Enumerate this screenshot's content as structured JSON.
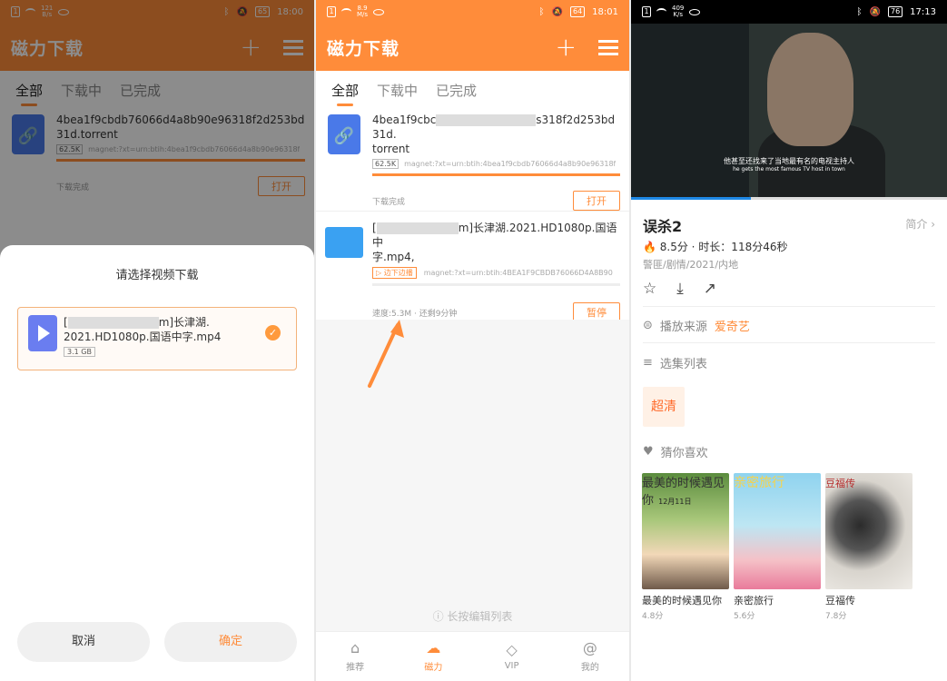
{
  "panel1": {
    "status": {
      "speed_top": "121",
      "speed_unit": "B/s",
      "battery": "65",
      "time": "18:00"
    },
    "appbar": {
      "title": "磁力下载"
    },
    "tabs": [
      "全部",
      "下载中",
      "已完成"
    ],
    "item": {
      "name": "4bea1f9cbdb76066d4a8b90e96318f2d253bd31d.torrent",
      "size": "62.5K",
      "magnet": "magnet:?xt=urn:btih:4bea1f9cbdb76066d4a8b90e96318f",
      "progress_fraction": 1.0,
      "status": "下载完成",
      "action": "打开"
    },
    "sheet": {
      "title": "请选择视频下载",
      "file_prefix": "[",
      "file_suffix": "m]长津湖.",
      "file_line2": "2021.HD1080p.国语中字.mp4",
      "file_size": "3.1 GB",
      "check": "✓",
      "cancel": "取消",
      "confirm": "确定"
    }
  },
  "panel2": {
    "status": {
      "speed_top": "8.9",
      "speed_unit": "M/s",
      "battery": "64",
      "time": "18:01"
    },
    "appbar": {
      "title": "磁力下载"
    },
    "tabs": [
      "全部",
      "下载中",
      "已完成"
    ],
    "item1": {
      "name_start": "4bea1f9cbc",
      "name_end": "s318f2d253bd31d.",
      "name_line2": "torrent",
      "size": "62.5K",
      "magnet": "magnet:?xt=urn:btih:4bea1f9cbdb76066d4a8b90e96318f",
      "progress_fraction": 1.0,
      "status": "下载完成",
      "action": "打开"
    },
    "item2": {
      "name_prefix": "[",
      "name_mid": "m]长津湖.2021.HD1080p.国语中",
      "name_line2": "字.mp4,",
      "tag": "▷ 边下边播",
      "magnet": "magnet:?xt=urn:btih:4BEA1F9CBDB76066D4A8B90",
      "status": "速度:5.3M · 还剩9分钟",
      "action": "暂停"
    },
    "hint": "长按编辑列表",
    "nav": [
      {
        "label": "推荐",
        "icon": "home-icon"
      },
      {
        "label": "磁力",
        "icon": "cloud-download-icon"
      },
      {
        "label": "VIP",
        "icon": "diamond-icon"
      },
      {
        "label": "我的",
        "icon": "at-icon"
      }
    ]
  },
  "panel3": {
    "status": {
      "speed_top": "409",
      "speed_unit": "K/s",
      "battery": "76",
      "time": "17:13"
    },
    "video": {
      "subtitle_cn": "他甚至还找来了当地最有名的电视主持人",
      "subtitle_en": "he gets the most famous TV host in town",
      "progress_fraction": 0.38
    },
    "movie": {
      "title": "误杀2",
      "intro": "简介 ›",
      "rating": "8.5分 · 时长：118分46秒",
      "genre": "警匪/剧情/2021/内地"
    },
    "source_label": "播放来源",
    "source_value": "爱奇艺",
    "episodes_label": "选集列表",
    "quality": "超清",
    "recommend_label": "猜你喜欢",
    "posters": [
      {
        "name": "最美的时候遇见你",
        "score": "4.8分",
        "art_text": "最美的时候遇见你",
        "date": "12月11日"
      },
      {
        "name": "亲密旅行",
        "score": "5.6分",
        "art_text": "亲密旅行"
      },
      {
        "name": "豆福传",
        "score": "7.8分",
        "art_text": "豆福传"
      }
    ]
  }
}
